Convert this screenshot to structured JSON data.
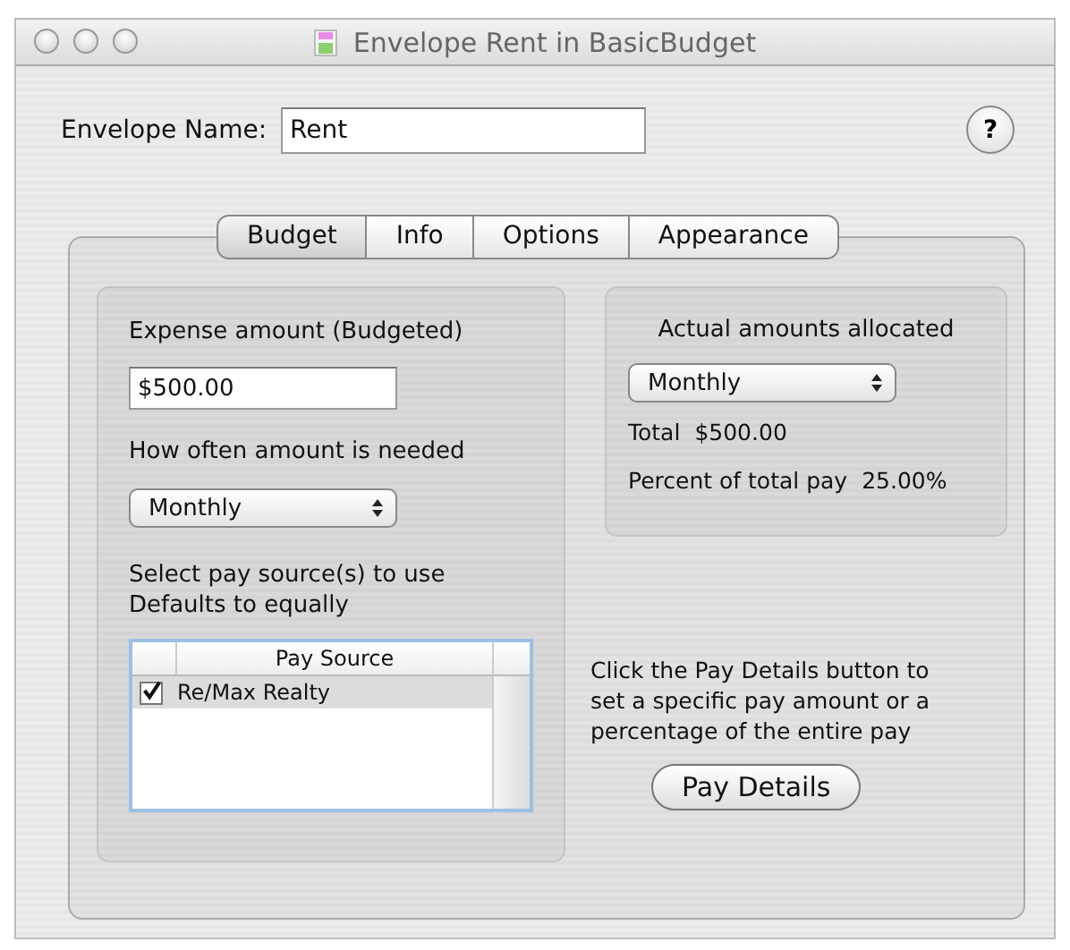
{
  "window": {
    "title": "Envelope Rent in BasicBudget"
  },
  "envelope_name": {
    "label": "Envelope Name:",
    "value": "Rent"
  },
  "help_button": {
    "label": "?"
  },
  "tabs": [
    {
      "label": "Budget",
      "selected": true
    },
    {
      "label": "Info",
      "selected": false
    },
    {
      "label": "Options",
      "selected": false
    },
    {
      "label": "Appearance",
      "selected": false
    }
  ],
  "budget": {
    "expense_label": "Expense amount (Budgeted)",
    "expense_value": "$500.00",
    "frequency_label": "How often amount is needed",
    "frequency": "Monthly",
    "pay_source_lines": [
      "Select pay source(s) to use",
      "Defaults to equally"
    ],
    "pay_source_table": {
      "column": "Pay Source",
      "rows": [
        {
          "name": "Re/Max Realty",
          "checked": true,
          "selected": true
        }
      ]
    }
  },
  "actual": {
    "title": "Actual amounts allocated",
    "period": "Monthly",
    "total_label": "Total",
    "total": "$500.00",
    "percent_label": "Percent of total pay",
    "percent": "25.00%"
  },
  "pay_details": {
    "note_lines": [
      "Click the Pay Details button to",
      "set a specific pay amount or a",
      "percentage of the entire pay"
    ],
    "button": "Pay Details"
  }
}
